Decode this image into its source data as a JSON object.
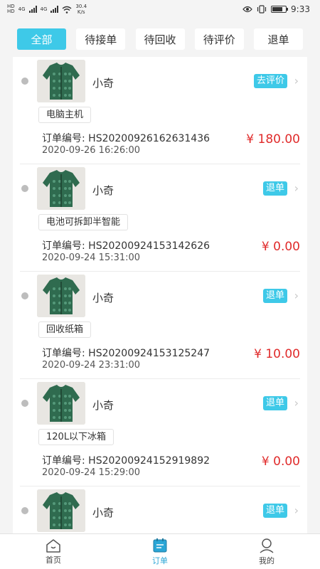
{
  "status_bar": {
    "left_labels": [
      "HD",
      "4G",
      "4G"
    ],
    "speed_value": "30.4",
    "speed_unit": "K/s",
    "time": "9:33",
    "icons": [
      "eye-icon",
      "vibrate-icon",
      "battery-icon"
    ]
  },
  "tabs": [
    {
      "label": "全部",
      "active": true
    },
    {
      "label": "待接单",
      "active": false
    },
    {
      "label": "待回收",
      "active": false
    },
    {
      "label": "待评价",
      "active": false
    },
    {
      "label": "退单",
      "active": false
    }
  ],
  "orders": [
    {
      "shop": "小奇",
      "action": "去评价",
      "item": "电脑主机",
      "order_label": "订单编号:",
      "order_no": "HS20200926162631436",
      "time": "2020-09-26 16:26:00",
      "price": "¥ 180.00"
    },
    {
      "shop": "小奇",
      "action": "退单",
      "item": "电池可拆卸半智能",
      "order_label": "订单编号:",
      "order_no": "HS20200924153142626",
      "time": "2020-09-24 15:31:00",
      "price": "¥ 0.00"
    },
    {
      "shop": "小奇",
      "action": "退单",
      "item": "回收纸箱",
      "order_label": "订单编号:",
      "order_no": "HS20200924153125247",
      "time": "2020-09-24 23:31:00",
      "price": "¥ 10.00"
    },
    {
      "shop": "小奇",
      "action": "退单",
      "item": "120L以下冰箱",
      "order_label": "订单编号:",
      "order_no": "HS20200924152919892",
      "time": "2020-09-24 15:29:00",
      "price": "¥ 0.00"
    },
    {
      "shop": "小奇",
      "action": "退单",
      "item": "",
      "order_label": "",
      "order_no": "",
      "time": "",
      "price": ""
    }
  ],
  "bottom_nav": [
    {
      "label": "首页",
      "icon": "home-icon",
      "active": false
    },
    {
      "label": "订单",
      "icon": "orders-icon",
      "active": true
    },
    {
      "label": "我的",
      "icon": "profile-icon",
      "active": false
    }
  ],
  "colors": {
    "accent": "#3ec9e8",
    "price": "#e02b2b",
    "nav_active": "#2aa6d6"
  }
}
